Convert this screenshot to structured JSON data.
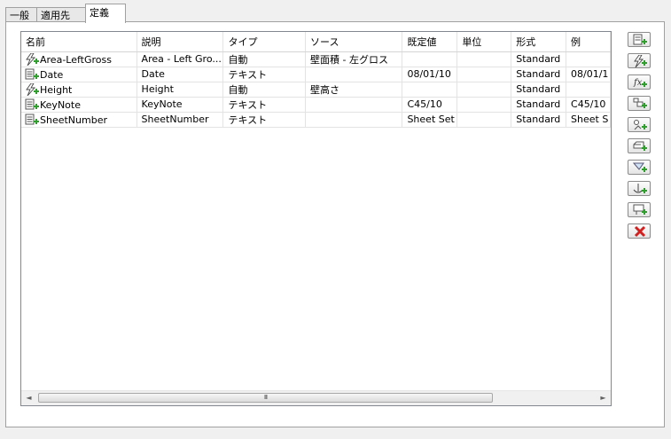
{
  "tabs": [
    {
      "label": "一般",
      "active": false
    },
    {
      "label": "適用先",
      "active": false
    },
    {
      "label": "定義",
      "active": true
    }
  ],
  "table": {
    "columns": [
      "名前",
      "説明",
      "タイプ",
      "ソース",
      "既定値",
      "単位",
      "形式",
      "例"
    ],
    "rows": [
      {
        "icon": "auto-property-icon",
        "cells": [
          "Area-LeftGross",
          "Area - Left Gro...",
          "自動",
          "壁面積 - 左グロス",
          "",
          "",
          "Standard",
          ""
        ]
      },
      {
        "icon": "text-property-icon",
        "cells": [
          "Date",
          "Date",
          "テキスト",
          "",
          "08/01/10",
          "",
          "Standard",
          "08/01/1"
        ]
      },
      {
        "icon": "auto-property-icon",
        "cells": [
          "Height",
          "Height",
          "自動",
          "壁高さ",
          "",
          "",
          "Standard",
          ""
        ]
      },
      {
        "icon": "text-property-icon",
        "cells": [
          "KeyNote",
          "KeyNote",
          "テキスト",
          "",
          "C45/10",
          "",
          "Standard",
          "C45/10"
        ]
      },
      {
        "icon": "text-property-icon",
        "cells": [
          "SheetNumber",
          "SheetNumber",
          "テキスト",
          "",
          "Sheet Set",
          "",
          "Standard",
          "Sheet S"
        ]
      }
    ]
  },
  "scrollbar": {
    "thumb_grip": "III"
  },
  "toolbar": [
    {
      "icon": "add-text-property-icon"
    },
    {
      "icon": "add-auto-property-icon"
    },
    {
      "icon": "add-formula-property-icon"
    },
    {
      "icon": "add-location-property-icon"
    },
    {
      "icon": "add-classification-property-icon"
    },
    {
      "icon": "add-material-property-icon"
    },
    {
      "icon": "add-graphic-property-icon"
    },
    {
      "icon": "add-anchor-property-icon"
    },
    {
      "icon": "add-property-set-property-icon"
    },
    {
      "icon": "delete-property-icon"
    }
  ],
  "colors": {
    "accent_green": "#2f9e2f",
    "delete_red": "#d02020"
  }
}
